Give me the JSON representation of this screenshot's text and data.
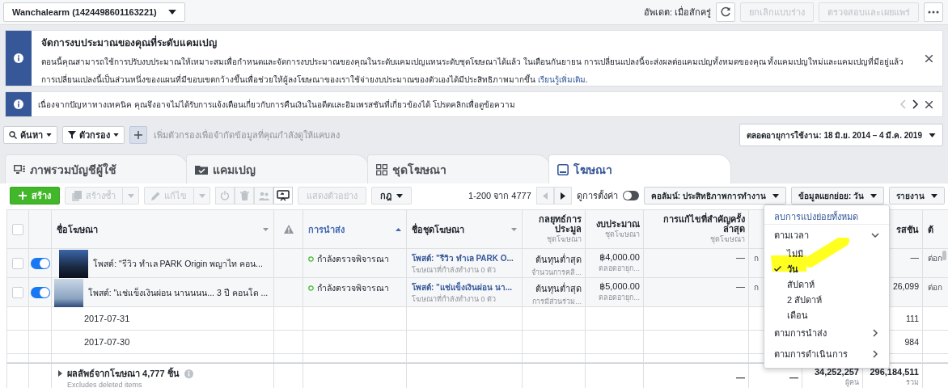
{
  "account_selector": {
    "label": "Wanchalearm (1424498601163221)"
  },
  "top_actions": {
    "update_status": "อัพเดต: เมื่อสักครู่",
    "buttons": [
      {
        "label": "ยกเลิกแบบร่าง",
        "disabled": true
      },
      {
        "label": "ตรวจสอบและเผยแพร่",
        "disabled": true
      }
    ]
  },
  "notices": [
    {
      "kind": "full",
      "title": "จัดการงบประมาณของคุณที่ระดับแคมเปญ",
      "lines": [
        "ตอนนี้คุณสามารถใช้การปรับงบประมาณให้เหมาะสมเพื่อกำหนดและจัดการงบประมาณของคุณในระดับแคมเปญแทนระดับชุดโฆษณาได้แล้ว ในเดือนกันยายน การเปลี่ยนแปลงนี้จะส่งผลต่อแคมเปญทั้งหมดของคุณ ทั้งแคมเปญใหม่และแคมเปญที่มีอยู่แล้ว",
        "การเปลี่ยนแปลงนี้เป็นส่วนหนึ่งของแผนที่มีขอบเขตกว้างขึ้นเพื่อช่วยให้ผู้ลงโฆษณาของเราใช้จ่ายงบประมาณของตัวเองได้มีประสิทธิภาพมากขึ้น"
      ],
      "link": "เรียนรู้เพิ่มเติม",
      "link_end": "."
    },
    {
      "kind": "compact",
      "text": "เนื่องจากปัญหาทางเทคนิค คุณจึงอาจไม่ได้รับการแจ้งเตือนเกี่ยวกับการคืนเงินในอดีตและอิมเพรสชันที่เกี่ยวข้องได้ โปรดคลิกเพื่อดูข้อความ"
    }
  ],
  "filter_bar": {
    "search": "ค้นหา",
    "filter": "ตัวกรอง",
    "placeholder": "เพิ่มตัวกรองเพื่อจำกัดข้อมูลที่คุณกำลังดูให้แคบลง",
    "date_range": "ตลอดอายุการใช้งาน: 18 มิ.ย. 2014 – 4 มี.ค. 2019"
  },
  "tabs": [
    {
      "label": "ภาพรวมบัญชีผู้ใช้",
      "kind": "account",
      "selected": false
    },
    {
      "label": "แคมเปญ",
      "kind": "campaign",
      "selected": false
    },
    {
      "label": "ชุดโฆษณา",
      "kind": "adset",
      "selected": false
    },
    {
      "label": "โฆษณา",
      "kind": "ad",
      "selected": true
    }
  ],
  "toolbar": {
    "create": "สร้าง",
    "duplicate": {
      "label": "สร้างซ้ำ",
      "disabled": true
    },
    "edit": {
      "label": "แก้ไข",
      "disabled": true
    },
    "icon_buttons": [
      {
        "kind": "power",
        "disabled": true
      },
      {
        "kind": "trash",
        "disabled": true
      },
      {
        "kind": "people",
        "disabled": true
      },
      {
        "kind": "preview",
        "disabled": false
      }
    ],
    "preview": {
      "label": "แสดงตัวอย่าง",
      "disabled": true
    },
    "rules": "กฎ",
    "pagination": "1-200 จาก 4777",
    "view_setup": {
      "label": "ดูการตั้งค่า",
      "on": false
    },
    "columns": "คอลัมน์: ประสิทธิภาพการทำงาน",
    "breakdown": "ข้อมูลแยกย่อย: วัน",
    "reports": "รายงาน"
  },
  "table": {
    "header": {
      "select_all_checked": false,
      "ad_name": {
        "label": "ชื่อโฆษณา",
        "sorted": false
      },
      "delivery": {
        "label": "การนำส่ง",
        "sorted": true
      },
      "ad_set": {
        "label": "ชื่อชุดโฆษณา",
        "sorted": false
      },
      "bid": {
        "label": "กลยุทธ์การประมูล",
        "sub": "ชุดโฆษณา"
      },
      "budget": {
        "label": "งบประมาณ",
        "sub": "ชุดโฆษณา"
      },
      "last_edit": {
        "label": "การแก้ไขที่สำคัญครั้งล่าสุด",
        "sub": "ชุดโฆษณา"
      },
      "impressions": "รสชัน",
      "column_12": "ต้"
    },
    "rows": [
      {
        "kind": "ad",
        "checked": false,
        "on": true,
        "name": "โพสต์: \"รีวิว ทำเล PARK Origin พญาไท คอน...",
        "delivery": "กำลังตรวจพิจารณา",
        "ad_set": {
          "text": "โพสต์: \"รีวิว ทำเล PARK O...",
          "sub": "โฆษณาที่กำลังทำงาน 0 ตัว"
        },
        "bid": {
          "text": "ต้นทุนต่ำสุด",
          "sub": "จำนวนการคลิ..."
        },
        "budget": {
          "text": "฿4,000.00",
          "sub": "ตลอดอายุก..."
        },
        "last_edit": "—",
        "column_10": "ก",
        "impressions": "—",
        "column_12": "ต่อก"
      },
      {
        "kind": "ad",
        "checked": false,
        "on": true,
        "name": "โพสต์: \"แช่แข็งเงินผ่อน นานนนน... 3 ปี คอนโด ...",
        "delivery": "กำลังตรวจพิจารณา",
        "ad_set": {
          "text": "โพสต์: \"แช่แข็งเงินผ่อน นา...",
          "sub": "โฆษณาที่กำลังทำงาน 0 ตัว"
        },
        "bid": {
          "text": "ต้นทุนต่ำสุด",
          "sub": "การมีส่วนร่วม..."
        },
        "budget": {
          "text": "฿5,000.00",
          "sub": "ตลอดอายุก..."
        },
        "last_edit": "—",
        "column_10": "ก",
        "impressions": "26,099",
        "column_12": "ต่อก"
      },
      {
        "kind": "date",
        "date": "2017-07-31",
        "impressions": "111"
      },
      {
        "kind": "date",
        "date": "2017-07-30",
        "impressions": "984"
      }
    ],
    "footer": {
      "summary": "ผลลัพธ์จากโฆษณา 4,777 ชิ้น",
      "note": "Excludes deleted items",
      "last_edit": "—",
      "column_10": "—",
      "reach": {
        "text": "34,252,257",
        "sub": "ผู้คน"
      },
      "impressions": {
        "text": "296,184,511",
        "sub": "รวม"
      }
    }
  },
  "breakdown_menu": {
    "clear": "ลบการแบ่งย่อยทั้งหมด",
    "groups": [
      {
        "label": "ตามเวลา",
        "expanded": true,
        "options": [
          {
            "label": "ไม่มี",
            "selected": false
          },
          {
            "label": "วัน",
            "selected": true
          },
          {
            "label": "สัปดาห์",
            "selected": false
          },
          {
            "label": "2 สัปดาห์",
            "selected": false
          },
          {
            "label": "เดือน",
            "selected": false
          }
        ]
      },
      {
        "label": "ตามการนำส่ง",
        "expanded": false
      },
      {
        "label": "ตามการดำเนินการ",
        "expanded": false
      }
    ]
  }
}
